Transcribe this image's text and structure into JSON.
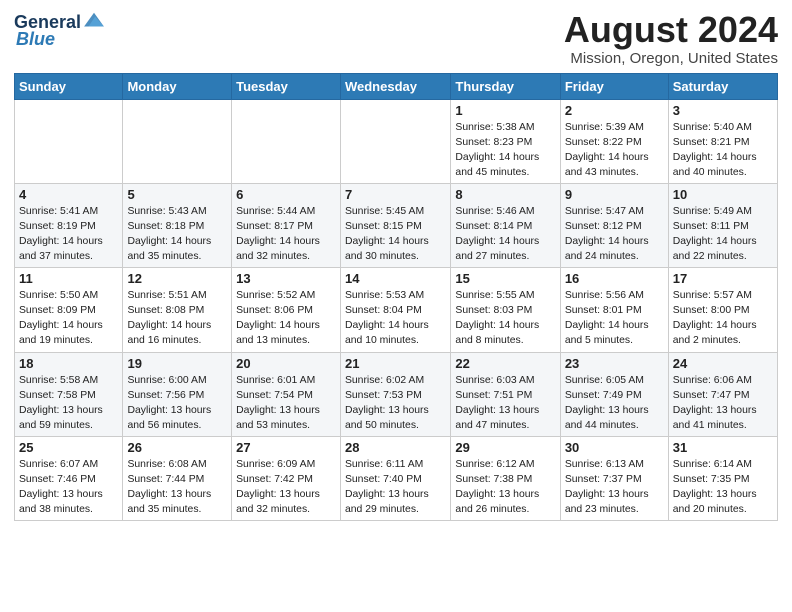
{
  "header": {
    "logo_line1": "General",
    "logo_line2": "Blue",
    "month": "August 2024",
    "location": "Mission, Oregon, United States"
  },
  "weekdays": [
    "Sunday",
    "Monday",
    "Tuesday",
    "Wednesday",
    "Thursday",
    "Friday",
    "Saturday"
  ],
  "weeks": [
    [
      {
        "day": "",
        "info": ""
      },
      {
        "day": "",
        "info": ""
      },
      {
        "day": "",
        "info": ""
      },
      {
        "day": "",
        "info": ""
      },
      {
        "day": "1",
        "info": "Sunrise: 5:38 AM\nSunset: 8:23 PM\nDaylight: 14 hours\nand 45 minutes."
      },
      {
        "day": "2",
        "info": "Sunrise: 5:39 AM\nSunset: 8:22 PM\nDaylight: 14 hours\nand 43 minutes."
      },
      {
        "day": "3",
        "info": "Sunrise: 5:40 AM\nSunset: 8:21 PM\nDaylight: 14 hours\nand 40 minutes."
      }
    ],
    [
      {
        "day": "4",
        "info": "Sunrise: 5:41 AM\nSunset: 8:19 PM\nDaylight: 14 hours\nand 37 minutes."
      },
      {
        "day": "5",
        "info": "Sunrise: 5:43 AM\nSunset: 8:18 PM\nDaylight: 14 hours\nand 35 minutes."
      },
      {
        "day": "6",
        "info": "Sunrise: 5:44 AM\nSunset: 8:17 PM\nDaylight: 14 hours\nand 32 minutes."
      },
      {
        "day": "7",
        "info": "Sunrise: 5:45 AM\nSunset: 8:15 PM\nDaylight: 14 hours\nand 30 minutes."
      },
      {
        "day": "8",
        "info": "Sunrise: 5:46 AM\nSunset: 8:14 PM\nDaylight: 14 hours\nand 27 minutes."
      },
      {
        "day": "9",
        "info": "Sunrise: 5:47 AM\nSunset: 8:12 PM\nDaylight: 14 hours\nand 24 minutes."
      },
      {
        "day": "10",
        "info": "Sunrise: 5:49 AM\nSunset: 8:11 PM\nDaylight: 14 hours\nand 22 minutes."
      }
    ],
    [
      {
        "day": "11",
        "info": "Sunrise: 5:50 AM\nSunset: 8:09 PM\nDaylight: 14 hours\nand 19 minutes."
      },
      {
        "day": "12",
        "info": "Sunrise: 5:51 AM\nSunset: 8:08 PM\nDaylight: 14 hours\nand 16 minutes."
      },
      {
        "day": "13",
        "info": "Sunrise: 5:52 AM\nSunset: 8:06 PM\nDaylight: 14 hours\nand 13 minutes."
      },
      {
        "day": "14",
        "info": "Sunrise: 5:53 AM\nSunset: 8:04 PM\nDaylight: 14 hours\nand 10 minutes."
      },
      {
        "day": "15",
        "info": "Sunrise: 5:55 AM\nSunset: 8:03 PM\nDaylight: 14 hours\nand 8 minutes."
      },
      {
        "day": "16",
        "info": "Sunrise: 5:56 AM\nSunset: 8:01 PM\nDaylight: 14 hours\nand 5 minutes."
      },
      {
        "day": "17",
        "info": "Sunrise: 5:57 AM\nSunset: 8:00 PM\nDaylight: 14 hours\nand 2 minutes."
      }
    ],
    [
      {
        "day": "18",
        "info": "Sunrise: 5:58 AM\nSunset: 7:58 PM\nDaylight: 13 hours\nand 59 minutes."
      },
      {
        "day": "19",
        "info": "Sunrise: 6:00 AM\nSunset: 7:56 PM\nDaylight: 13 hours\nand 56 minutes."
      },
      {
        "day": "20",
        "info": "Sunrise: 6:01 AM\nSunset: 7:54 PM\nDaylight: 13 hours\nand 53 minutes."
      },
      {
        "day": "21",
        "info": "Sunrise: 6:02 AM\nSunset: 7:53 PM\nDaylight: 13 hours\nand 50 minutes."
      },
      {
        "day": "22",
        "info": "Sunrise: 6:03 AM\nSunset: 7:51 PM\nDaylight: 13 hours\nand 47 minutes."
      },
      {
        "day": "23",
        "info": "Sunrise: 6:05 AM\nSunset: 7:49 PM\nDaylight: 13 hours\nand 44 minutes."
      },
      {
        "day": "24",
        "info": "Sunrise: 6:06 AM\nSunset: 7:47 PM\nDaylight: 13 hours\nand 41 minutes."
      }
    ],
    [
      {
        "day": "25",
        "info": "Sunrise: 6:07 AM\nSunset: 7:46 PM\nDaylight: 13 hours\nand 38 minutes."
      },
      {
        "day": "26",
        "info": "Sunrise: 6:08 AM\nSunset: 7:44 PM\nDaylight: 13 hours\nand 35 minutes."
      },
      {
        "day": "27",
        "info": "Sunrise: 6:09 AM\nSunset: 7:42 PM\nDaylight: 13 hours\nand 32 minutes."
      },
      {
        "day": "28",
        "info": "Sunrise: 6:11 AM\nSunset: 7:40 PM\nDaylight: 13 hours\nand 29 minutes."
      },
      {
        "day": "29",
        "info": "Sunrise: 6:12 AM\nSunset: 7:38 PM\nDaylight: 13 hours\nand 26 minutes."
      },
      {
        "day": "30",
        "info": "Sunrise: 6:13 AM\nSunset: 7:37 PM\nDaylight: 13 hours\nand 23 minutes."
      },
      {
        "day": "31",
        "info": "Sunrise: 6:14 AM\nSunset: 7:35 PM\nDaylight: 13 hours\nand 20 minutes."
      }
    ]
  ]
}
